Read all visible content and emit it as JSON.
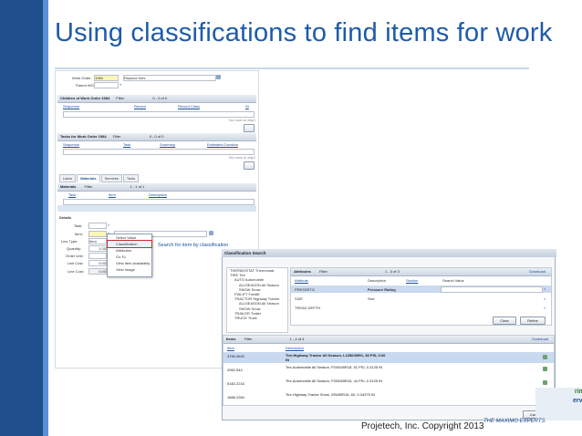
{
  "slide": {
    "title": "Using classifications to find items for work",
    "copyright": "Projetech, Inc. Copyright 2013",
    "brand": "THE MAXIMO EXPERTS",
    "logo_line1": "rimo",
    "logo_line2": "ervice"
  },
  "workorder": {
    "wo_label": "Work Order:",
    "wo_value": "1984",
    "wo_desc": "Replace tires",
    "parent_label": "Parent WO:"
  },
  "children_section": {
    "title": "Children of Work Order 1984",
    "filter": "Filter",
    "pager": "0 - 0 of 0",
    "columns": [
      "Sequence",
      "Record",
      "Record Class",
      "St"
    ],
    "empty": "No rows to displ"
  },
  "tasks_section": {
    "title": "Tasks for Work Order 1984",
    "filter": "Filter",
    "pager": "0 - 0 of 0",
    "columns": [
      "Sequence",
      "Task",
      "Summary",
      "Estimated Duration"
    ],
    "empty": "No rows to displ"
  },
  "plan_tabs": [
    "Labor",
    "Materials",
    "Services",
    "Tools"
  ],
  "materials": {
    "title": "Materials",
    "filter": "Filter",
    "pager": "1 - 1 of 1",
    "columns": [
      "Task",
      "Item",
      "Description"
    ],
    "details_label": "Details",
    "task_label": "Task:",
    "item_label": "Item:",
    "linetype_label": "Line Type:",
    "linetype_value": "Item",
    "quantity_label": "Quantity:",
    "quantity_value": "1.00",
    "orderunit_label": "Order Unit:",
    "unitcost_label": "Unit Cost:",
    "unitcost_value": "0.00",
    "linecost_label": "Line Cost:",
    "linecost_value": "0.00"
  },
  "context_menu": {
    "items": [
      "Select Value",
      "Classification",
      "Attributes",
      "Go To",
      "View Item Availability",
      "View Image"
    ]
  },
  "annotation": "Search for item by classification",
  "classification_search": {
    "title": "Classification Search",
    "tree": [
      "THERMOSTAT Thermostat",
      "TIRE Tire",
      "AUTO Automobile",
      "ALLSEASON All Season",
      "SNOW Snow",
      "FWLIFT Forklift",
      "TRACTOR Highway Tractor",
      "ALLSEASON All Season",
      "SNOW Snow",
      "TRAILER Trailer",
      "TRUCK Truck"
    ],
    "attributes": {
      "title": "Attributes",
      "filter": "Filter",
      "pager": "1 - 3 of 3",
      "download": "Download",
      "columns": [
        "Attribute",
        "Description",
        "Section",
        "Search Value"
      ],
      "rows": [
        {
          "attr": "PRESSRTG",
          "desc": "Pressure Rating",
          "value": ""
        },
        {
          "attr": "SIZE",
          "desc": "Size",
          "value": ""
        },
        {
          "attr": "TREAD DEPTH",
          "desc": "",
          "value": ""
        }
      ],
      "clear": "Clear",
      "refine": "Refine"
    },
    "items": {
      "title": "Items",
      "filter": "Filter",
      "pager": "1 - 4 of 4",
      "download": "Download",
      "columns": [
        "Item",
        "Description"
      ],
      "rows": [
        {
          "item": "3750.0620",
          "desc": "Tire,Highway Tractor All Season, L1280/90R1, 80 PSI, 0.00 IN"
        },
        {
          "item": "2062.544",
          "desc": "Tire,Automobile All Season, P245/45R18, 51 PSI, 0.3125 IN"
        },
        {
          "item": "5182.2216",
          "desc": "Tire,Automobile All Season, P205/65R16, 44 PSI, 0.3125 IN"
        },
        {
          "item": "1666.2264",
          "desc": "Tire,Highway Tractor Snow, 295/80R16, 60, 0.34375 IN"
        }
      ],
      "cancel": "Cancel"
    }
  }
}
